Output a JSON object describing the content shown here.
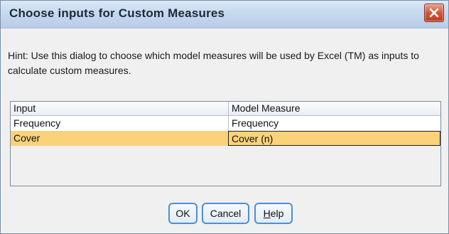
{
  "window": {
    "title": "Choose inputs for Custom Measures",
    "close_icon": "close-icon"
  },
  "hint": "Hint: Use this dialog to choose which model measures will be used by Excel (TM) as inputs to calculate custom measures.",
  "table": {
    "columns": [
      "Input",
      "Model Measure"
    ],
    "rows": [
      {
        "input": "Frequency",
        "measure": "Frequency"
      },
      {
        "input": "Cover",
        "measure": "Cover (n)"
      }
    ],
    "selected_row_color": "#f9d27a"
  },
  "buttons": {
    "ok": "OK",
    "cancel": "Cancel",
    "help_first": "H",
    "help_rest": "elp"
  },
  "colors": {
    "title_bar": "#c3d6ec",
    "close_button": "#d2563a",
    "button_border": "#4f8fd1"
  }
}
